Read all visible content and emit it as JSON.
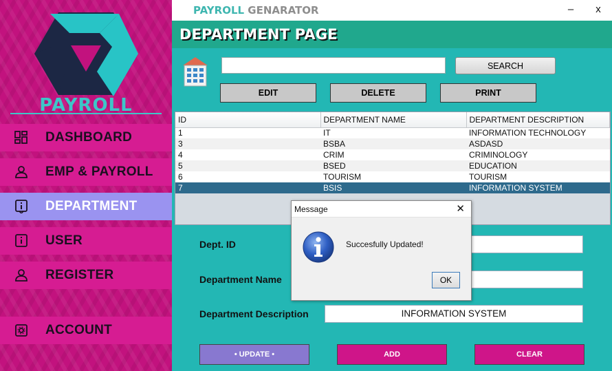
{
  "app": {
    "title_part1": "PAYROLL",
    "title_part2": " GENARATOR",
    "minimize": "–",
    "close": "x"
  },
  "sidebar": {
    "logo_text": "PAYROLL",
    "items": [
      {
        "label": "DASHBOARD",
        "icon": "dashboard-icon",
        "active": false
      },
      {
        "label": "EMP & PAYROLL",
        "icon": "user-icon",
        "active": false
      },
      {
        "label": "DEPARTMENT",
        "icon": "info-icon",
        "active": true
      },
      {
        "label": "USER",
        "icon": "info-icon",
        "active": false
      },
      {
        "label": "REGISTER",
        "icon": "user-icon",
        "active": false
      },
      {
        "label": "ACCOUNT",
        "icon": "settings-icon",
        "active": false
      }
    ]
  },
  "page": {
    "title": "DEPARTMENT PAGE",
    "search_value": "",
    "search_button": "SEARCH",
    "edit_button": "EDIT",
    "delete_button": "DELETE",
    "print_button": "PRINT"
  },
  "table": {
    "columns": [
      "ID",
      "DEPARTMENT NAME",
      "DEPARTMENT DESCRIPTION"
    ],
    "rows": [
      [
        "1",
        "IT",
        "INFORMATION TECHNOLOGY"
      ],
      [
        "3",
        "BSBA",
        "ASDASD"
      ],
      [
        "4",
        "CRIM",
        "CRIMINOLOGY"
      ],
      [
        "5",
        "BSED",
        "EDUCATION"
      ],
      [
        "6",
        "TOURISM",
        "TOURISM"
      ],
      [
        "7",
        "BSIS",
        "INFORMATION SYSTEM"
      ]
    ],
    "selected_row": 5
  },
  "form": {
    "dept_id_label": "Dept. ID",
    "dept_id_value": "",
    "dept_name_label": "Department Name",
    "dept_name_value": "",
    "dept_desc_label": "Department Description",
    "dept_desc_value": "INFORMATION SYSTEM"
  },
  "buttons": {
    "update": "• UPDATE •",
    "add": "ADD",
    "clear": "CLEAR"
  },
  "dialog": {
    "title": "Message",
    "close": "✕",
    "message": "Succesfully Updated!",
    "ok": "OK"
  },
  "colors": {
    "sidebar": "#c2127e",
    "nav_item": "#d61c92",
    "nav_active": "#9a93f0",
    "header": "#20a88d",
    "main": "#23b7b4",
    "table_selected": "#2e6a8c",
    "button_magenta": "#cf1589",
    "button_update": "#8878d0"
  }
}
